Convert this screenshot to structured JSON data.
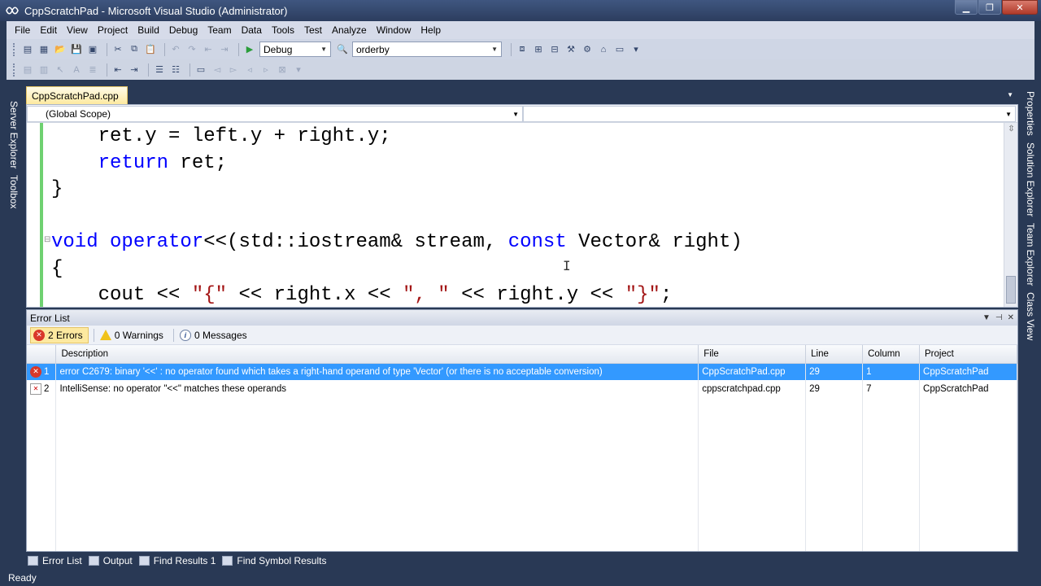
{
  "window": {
    "title": "CppScratchPad - Microsoft Visual Studio (Administrator)",
    "buttons": {
      "minimize": "▁",
      "restore": "❐",
      "close": "✕"
    }
  },
  "menu": [
    "File",
    "Edit",
    "View",
    "Project",
    "Build",
    "Debug",
    "Team",
    "Data",
    "Tools",
    "Test",
    "Analyze",
    "Window",
    "Help"
  ],
  "toolbar": {
    "configuration": "Debug",
    "find_box": "orderby"
  },
  "left_tabs": [
    "Server Explorer",
    "Toolbox"
  ],
  "right_tabs": [
    "Properties",
    "Solution Explorer",
    "Team Explorer",
    "Class View"
  ],
  "document_tab": "CppScratchPad.cpp",
  "editor": {
    "scope": "(Global Scope)",
    "member": "",
    "lines": [
      [
        {
          "t": "    ret.y = left.y + right.y;",
          "c": ""
        }
      ],
      [
        {
          "t": "    ",
          "c": ""
        },
        {
          "t": "return",
          "c": "kw"
        },
        {
          "t": " ret;",
          "c": ""
        }
      ],
      [
        {
          "t": "}",
          "c": ""
        }
      ],
      [
        {
          "t": "",
          "c": ""
        }
      ],
      [
        {
          "t": "void",
          "c": "kw"
        },
        {
          "t": " ",
          "c": ""
        },
        {
          "t": "operator",
          "c": "kw"
        },
        {
          "t": "<<(std::iostream& stream, ",
          "c": ""
        },
        {
          "t": "const",
          "c": "kw"
        },
        {
          "t": " Vector& right)",
          "c": ""
        }
      ],
      [
        {
          "t": "{",
          "c": ""
        }
      ],
      [
        {
          "t": "    cout << ",
          "c": ""
        },
        {
          "t": "\"{\"",
          "c": "str"
        },
        {
          "t": " << right.x << ",
          "c": ""
        },
        {
          "t": "\", \"",
          "c": "str"
        },
        {
          "t": " << right.y << ",
          "c": ""
        },
        {
          "t": "\"}\"",
          "c": "str"
        },
        {
          "t": ";",
          "c": ""
        }
      ]
    ]
  },
  "error_list": {
    "title": "Error List",
    "filters": {
      "errors": "2 Errors",
      "warnings": "0 Warnings",
      "messages": "0 Messages"
    },
    "columns": [
      "Description",
      "File",
      "Line",
      "Column",
      "Project"
    ],
    "rows": [
      {
        "num": "1",
        "description": "error C2679: binary '<<' : no operator found which takes a right-hand operand of type 'Vector' (or there is no acceptable conversion)",
        "file": "CppScratchPad.cpp",
        "line": "29",
        "column": "1",
        "project": "CppScratchPad",
        "type": "error"
      },
      {
        "num": "2",
        "description": "IntelliSense: no operator \"<<\" matches these operands",
        "file": "cppscratchpad.cpp",
        "line": "29",
        "column": "7",
        "project": "CppScratchPad",
        "type": "intellisense"
      }
    ]
  },
  "bottom_tabs": [
    "Error List",
    "Output",
    "Find Results 1",
    "Find Symbol Results"
  ],
  "status": "Ready"
}
